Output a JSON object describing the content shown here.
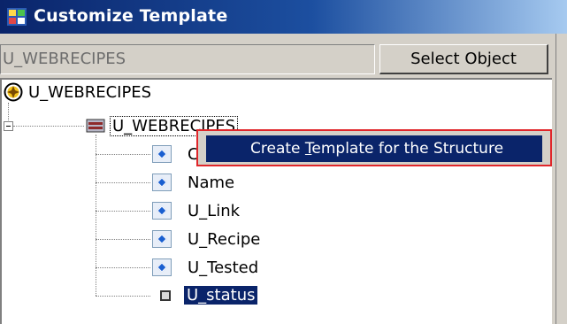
{
  "window": {
    "title": "Customize Template"
  },
  "object_selector": {
    "value": "U_WEBRECIPES",
    "button_label": "Select Object"
  },
  "tree": {
    "root_label": "U_WEBRECIPES",
    "structure_label": "U_WEBRECIPES",
    "fields": [
      {
        "label": "Co",
        "type": "field"
      },
      {
        "label": "Name",
        "type": "field"
      },
      {
        "label": "U_Link",
        "type": "field"
      },
      {
        "label": "U_Recipe",
        "type": "field"
      },
      {
        "label": "U_Tested",
        "type": "field"
      },
      {
        "label": "U_status",
        "type": "status"
      }
    ]
  },
  "context_menu": {
    "item_label_prefix": "Create ",
    "item_accel": "T",
    "item_label_suffix": "emplate for the Structure"
  },
  "colors": {
    "titlebar": "#0a246a",
    "selection": "#0a246a",
    "highlight_border": "#e0262a"
  }
}
